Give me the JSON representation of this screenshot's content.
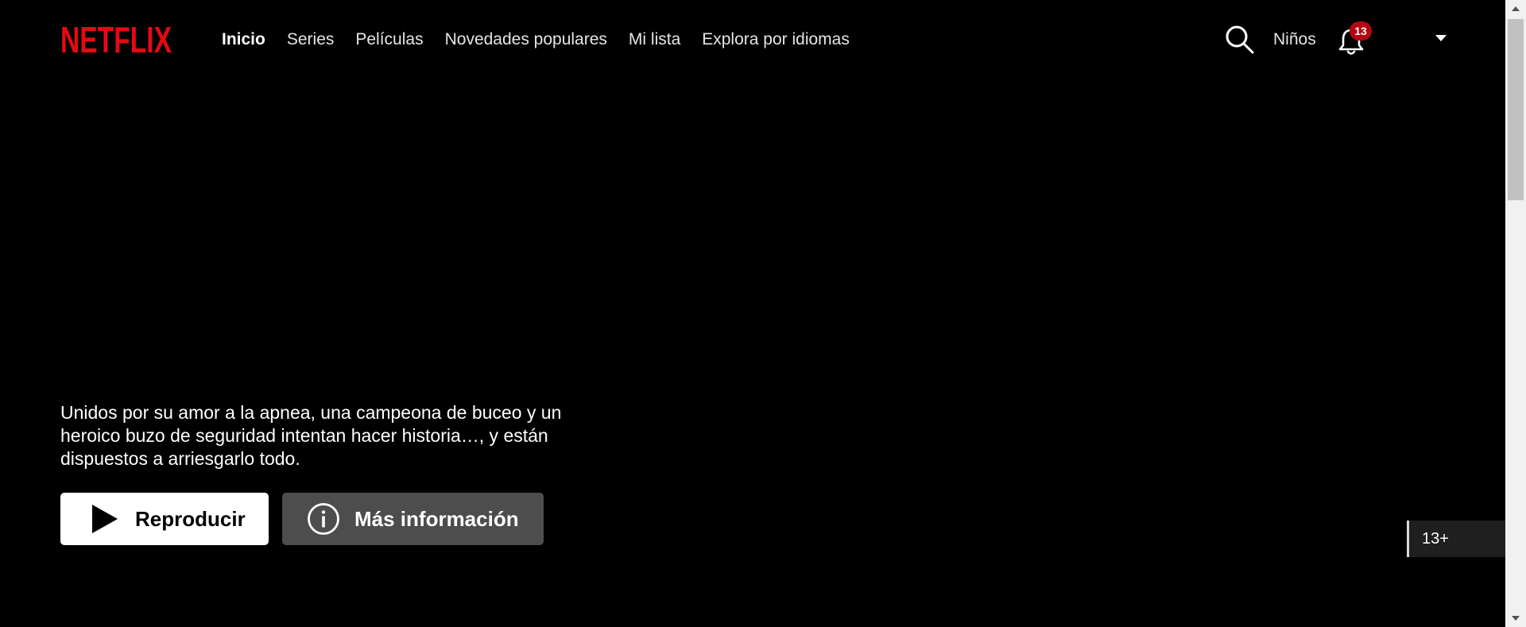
{
  "brand": {
    "logo_text": "NETFLIX",
    "color": "#E50914"
  },
  "nav": {
    "items": [
      {
        "label": "Inicio",
        "active": true
      },
      {
        "label": "Series"
      },
      {
        "label": "Películas"
      },
      {
        "label": "Novedades populares"
      },
      {
        "label": "Mi lista"
      },
      {
        "label": "Explora por idiomas"
      }
    ]
  },
  "right_nav": {
    "search_icon": "search-icon",
    "kids_label": "Niños",
    "bell_icon": "bell-icon",
    "notification_count": "13",
    "caret_icon": "caret-down-icon"
  },
  "hero": {
    "synopsis": "Unidos por su amor a la apnea, una campeona de buceo y un heroico buzo de seguridad intentan hacer historia…, y están dispuestos a arriesgarlo todo.",
    "play_label": "Reproducir",
    "info_label": "Más información",
    "maturity_rating": "13+"
  },
  "colors": {
    "background": "#000000",
    "badge": "#B20710",
    "info_button": "#6D6D6E"
  }
}
